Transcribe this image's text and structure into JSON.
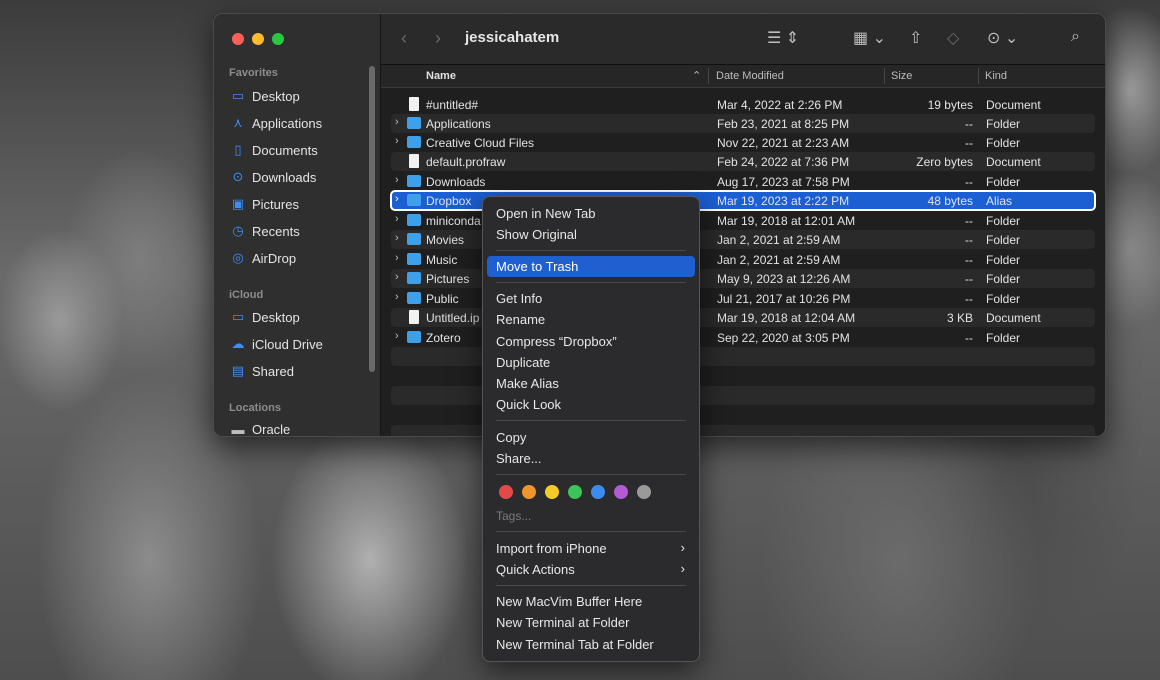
{
  "window": {
    "title": "jessicahatem"
  },
  "sidebar": {
    "favorites_label": "Favorites",
    "favorites": [
      {
        "label": "Desktop",
        "icon": "desktop-icon"
      },
      {
        "label": "Applications",
        "icon": "applications-icon"
      },
      {
        "label": "Documents",
        "icon": "documents-icon"
      },
      {
        "label": "Downloads",
        "icon": "downloads-icon"
      },
      {
        "label": "Pictures",
        "icon": "pictures-icon"
      },
      {
        "label": "Recents",
        "icon": "recents-icon"
      },
      {
        "label": "AirDrop",
        "icon": "airdrop-icon"
      }
    ],
    "icloud_label": "iCloud",
    "icloud": [
      {
        "label": "Desktop",
        "icon": "desktop-icon"
      },
      {
        "label": "iCloud Drive",
        "icon": "cloud-icon"
      },
      {
        "label": "Shared",
        "icon": "shared-folder-icon"
      }
    ],
    "locations_label": "Locations",
    "locations": [
      {
        "label": "Oracle",
        "icon": "drive-icon"
      }
    ]
  },
  "columns": {
    "name": "Name",
    "date": "Date Modified",
    "size": "Size",
    "kind": "Kind"
  },
  "files": [
    {
      "name": "#untitled#",
      "date": "Mar 4, 2022 at 2:26 PM",
      "size": "19 bytes",
      "kind": "Document",
      "type": "doc"
    },
    {
      "name": "Applications",
      "date": "Feb 23, 2021 at 8:25 PM",
      "size": "--",
      "kind": "Folder",
      "type": "folder"
    },
    {
      "name": "Creative Cloud Files",
      "date": "Nov 22, 2021 at 2:23 AM",
      "size": "--",
      "kind": "Folder",
      "type": "folder"
    },
    {
      "name": "default.profraw",
      "date": "Feb 24, 2022 at 7:36 PM",
      "size": "Zero bytes",
      "kind": "Document",
      "type": "doc"
    },
    {
      "name": "Downloads",
      "date": "Aug 17, 2023 at 7:58 PM",
      "size": "--",
      "kind": "Folder",
      "type": "folder"
    },
    {
      "name": "Dropbox",
      "date": "Mar 19, 2023 at 2:22 PM",
      "size": "48 bytes",
      "kind": "Alias",
      "type": "alias"
    },
    {
      "name": "miniconda",
      "date": "Mar 19, 2018 at 12:01 AM",
      "size": "--",
      "kind": "Folder",
      "type": "folder"
    },
    {
      "name": "Movies",
      "date": "Jan 2, 2021 at 2:59 AM",
      "size": "--",
      "kind": "Folder",
      "type": "folder"
    },
    {
      "name": "Music",
      "date": "Jan 2, 2021 at 2:59 AM",
      "size": "--",
      "kind": "Folder",
      "type": "folder"
    },
    {
      "name": "Pictures",
      "date": "May 9, 2023 at 12:26 AM",
      "size": "--",
      "kind": "Folder",
      "type": "folder"
    },
    {
      "name": "Public",
      "date": "Jul 21, 2017 at 10:26 PM",
      "size": "--",
      "kind": "Folder",
      "type": "folder"
    },
    {
      "name": "Untitled.ip",
      "date": "Mar 19, 2018 at 12:04 AM",
      "size": "3 KB",
      "kind": "Document",
      "type": "doc"
    },
    {
      "name": "Zotero",
      "date": "Sep 22, 2020 at 3:05 PM",
      "size": "--",
      "kind": "Folder",
      "type": "folder"
    }
  ],
  "context_menu": {
    "open_new_tab": "Open in New Tab",
    "show_original": "Show Original",
    "move_to_trash": "Move to Trash",
    "get_info": "Get Info",
    "rename": "Rename",
    "compress": "Compress “Dropbox”",
    "duplicate": "Duplicate",
    "make_alias": "Make Alias",
    "quick_look": "Quick Look",
    "copy": "Copy",
    "share": "Share...",
    "tags": "Tags...",
    "tag_colors": [
      "#e24a4a",
      "#f0952c",
      "#f4c92a",
      "#3bc458",
      "#3c8cf0",
      "#b45ad4",
      "#9a9a9a"
    ],
    "import_iphone": "Import from iPhone",
    "quick_actions": "Quick Actions",
    "macvim": "New MacVim Buffer Here",
    "terminal": "New Terminal at Folder",
    "terminal_tab": "New Terminal Tab at Folder"
  }
}
